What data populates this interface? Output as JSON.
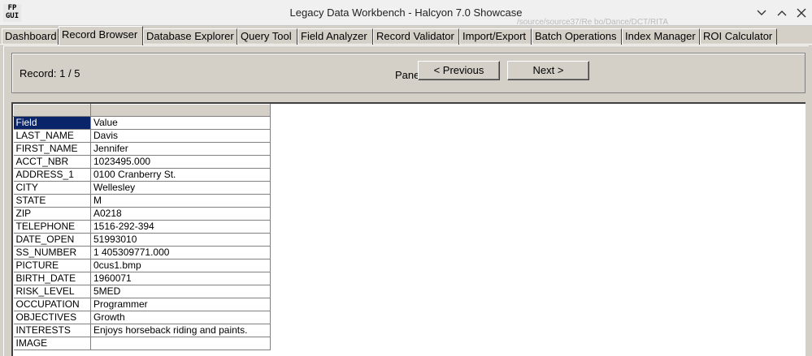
{
  "window": {
    "app_icon_text": "FP GUI",
    "title": "Legacy Data Workbench - Halcyon 7.0 Showcase",
    "background_text": "/source/source37/Re bo/Dance/DCT/RITA"
  },
  "tabs": [
    {
      "label": "Dashboard",
      "active": false
    },
    {
      "label": "Record Browser",
      "active": true
    },
    {
      "label": "Database Explorer",
      "active": false
    },
    {
      "label": "Query Tool",
      "active": false
    },
    {
      "label": "Field Analyzer",
      "active": false
    },
    {
      "label": "Record Validator",
      "active": false
    },
    {
      "label": "Import/Export",
      "active": false
    },
    {
      "label": "Batch Operations",
      "active": false
    },
    {
      "label": "Index Manager",
      "active": false
    },
    {
      "label": "ROI Calculator",
      "active": false
    }
  ],
  "nav": {
    "record_label": "Record: 1 / 5",
    "pane_label": "Pane",
    "previous_label": "< Previous",
    "next_label": "Next >"
  },
  "grid": {
    "headers": [
      "",
      ""
    ],
    "rows": [
      [
        "Field",
        "Value"
      ],
      [
        "LAST_NAME",
        "Davis"
      ],
      [
        "FIRST_NAME",
        "Jennifer"
      ],
      [
        "ACCT_NBR",
        "1023495.000"
      ],
      [
        "ADDRESS_1",
        "0100 Cranberry St."
      ],
      [
        "CITY",
        "Wellesley"
      ],
      [
        "STATE",
        "M"
      ],
      [
        "ZIP",
        "A0218"
      ],
      [
        "TELEPHONE",
        "1516-292-394"
      ],
      [
        "DATE_OPEN",
        "51993010"
      ],
      [
        "SS_NUMBER",
        "1      405309771.000"
      ],
      [
        "PICTURE",
        "0cus1.bmp"
      ],
      [
        "BIRTH_DATE",
        "1960071"
      ],
      [
        "RISK_LEVEL",
        "5MED"
      ],
      [
        "OCCUPATION",
        "Programmer"
      ],
      [
        "OBJECTIVES",
        "Growth"
      ],
      [
        "INTERESTS",
        "Enjoys horseback riding and paints."
      ],
      [
        "IMAGE",
        ""
      ]
    ],
    "selected_cell": "Field"
  }
}
